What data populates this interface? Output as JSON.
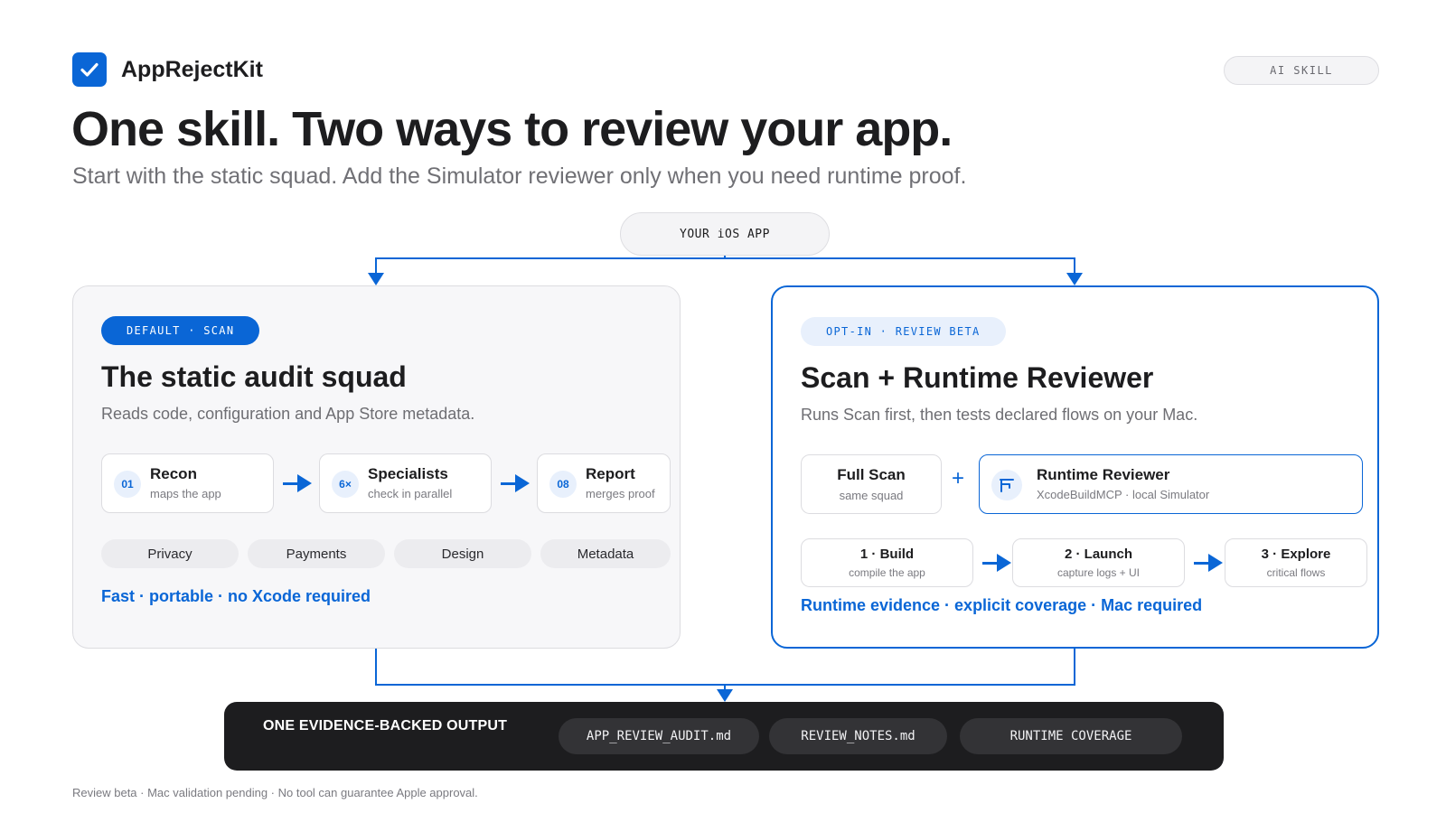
{
  "brand": {
    "name": "AppRejectKit",
    "logo_icon": "checkmark-icon"
  },
  "top_tag": "AI SKILL",
  "headline": "One skill. Two ways to review your app.",
  "subheadline": "Start with the static squad. Add the Simulator reviewer only when you need runtime proof.",
  "source_node": "YOUR iOS APP",
  "accent_color": "#0a66d6",
  "left_card": {
    "badge": "DEFAULT · SCAN",
    "title": "The static audit squad",
    "description": "Reads code, configuration and App Store metadata.",
    "steps": [
      {
        "num": "01",
        "title": "Recon",
        "sub": "maps the app"
      },
      {
        "num": "6×",
        "title": "Specialists",
        "sub": "check in parallel"
      },
      {
        "num": "08",
        "title": "Report",
        "sub": "merges proof"
      }
    ],
    "tags": [
      "Privacy",
      "Payments",
      "Design",
      "Metadata"
    ],
    "footnote": "Fast · portable · no Xcode required"
  },
  "right_card": {
    "badge": "OPT-IN · REVIEW BETA",
    "title": "Scan + Runtime Reviewer",
    "description": "Runs Scan first, then tests declared flows on your Mac.",
    "full_scan": {
      "title": "Full Scan",
      "sub": "same squad"
    },
    "plus": "+",
    "runtime": {
      "title": "Runtime Reviewer",
      "sub": "XcodeBuildMCP · local Simulator",
      "icon": "simulator-icon"
    },
    "steps": [
      {
        "title": "1 · Build",
        "sub": "compile the app"
      },
      {
        "title": "2 · Launch",
        "sub": "capture logs + UI"
      },
      {
        "title": "3 · Explore",
        "sub": "critical flows"
      }
    ],
    "footnote": "Runtime evidence · explicit coverage · Mac required"
  },
  "output": {
    "title": "ONE EVIDENCE-BACKED OUTPUT",
    "files": [
      "APP_REVIEW_AUDIT.md",
      "REVIEW_NOTES.md",
      "RUNTIME COVERAGE"
    ]
  },
  "disclaimer": "Review beta · Mac validation pending · No tool can guarantee Apple approval."
}
